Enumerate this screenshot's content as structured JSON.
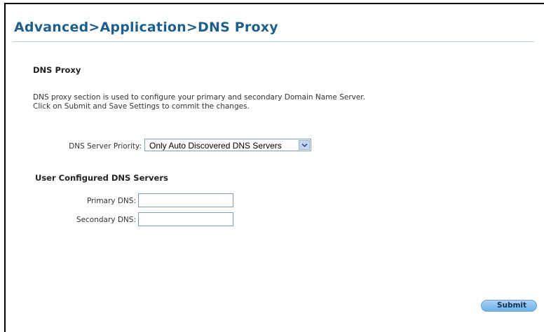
{
  "page": {
    "title": "Advanced>Application>DNS Proxy"
  },
  "section": {
    "heading": "DNS Proxy",
    "description_line1": "DNS proxy section is used to configure your primary and secondary Domain Name Server.",
    "description_line2": "Click on Submit and Save Settings to commit the changes."
  },
  "priority": {
    "label": "DNS Server Priority:",
    "selected_value": "Only Auto Discovered DNS Servers",
    "arrow_icon": "chevron-down-icon"
  },
  "user_dns": {
    "heading": "User Configured DNS Servers",
    "primary_label": "Primary DNS:",
    "primary_value": "",
    "secondary_label": "Secondary DNS:",
    "secondary_value": ""
  },
  "actions": {
    "submit_label": "Submit"
  },
  "colors": {
    "title": "#1f5f8b",
    "button_gradient_top": "#a7d2f6",
    "button_gradient_bottom": "#6fb0ea",
    "input_border": "#7f9db9"
  }
}
